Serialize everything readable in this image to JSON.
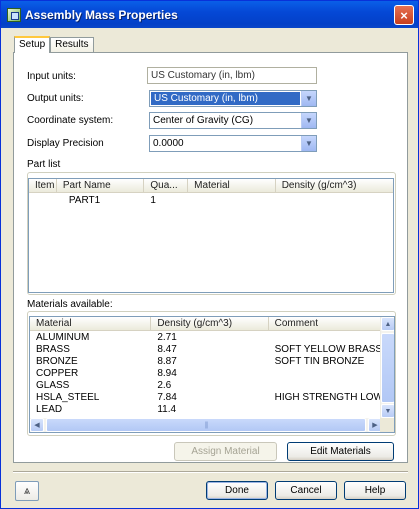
{
  "window": {
    "title": "Assembly Mass Properties",
    "close_glyph": "×"
  },
  "tabs": [
    {
      "label": "Setup",
      "active": true
    },
    {
      "label": "Results",
      "active": false
    }
  ],
  "setup": {
    "input_units": {
      "label": "Input units:",
      "value": "US Customary (in, lbm)"
    },
    "output_units": {
      "label": "Output units:",
      "value": "US Customary (in, lbm)"
    },
    "coordinate_system": {
      "label": "Coordinate system:",
      "value": "Center of Gravity (CG)"
    },
    "display_precision": {
      "label": "Display Precision",
      "value": "0.0000"
    }
  },
  "part_list": {
    "label": "Part list",
    "columns": [
      "Item",
      "Part Name",
      "Qua...",
      "Material",
      "Density (g/cm^3)"
    ],
    "rows": [
      [
        "",
        "PART1",
        "1",
        "",
        ""
      ]
    ]
  },
  "materials": {
    "label": "Materials available:",
    "columns": [
      "Material",
      "Density (g/cm^3)",
      "Comment"
    ],
    "rows": [
      [
        "ALUMINUM",
        "2.71",
        ""
      ],
      [
        "BRASS",
        "8.47",
        "SOFT YELLOW BRASS"
      ],
      [
        "BRONZE",
        "8.87",
        "SOFT TIN BRONZE"
      ],
      [
        "COPPER",
        "8.94",
        ""
      ],
      [
        "GLASS",
        "2.6",
        ""
      ],
      [
        "HSLA_STEEL",
        "7.84",
        "HIGH STRENGTH LOW"
      ],
      [
        "LEAD",
        "11.4",
        ""
      ]
    ]
  },
  "buttons": {
    "assign_material": "Assign Material",
    "edit_materials": "Edit Materials",
    "done": "Done",
    "cancel": "Cancel",
    "help": "Help"
  },
  "icons": {
    "dropdown": "▼",
    "scroll_up": "▲",
    "scroll_down": "▼",
    "scroll_left": "◀",
    "scroll_right": "▶",
    "collapse": "⩓",
    "grip": "|||"
  }
}
